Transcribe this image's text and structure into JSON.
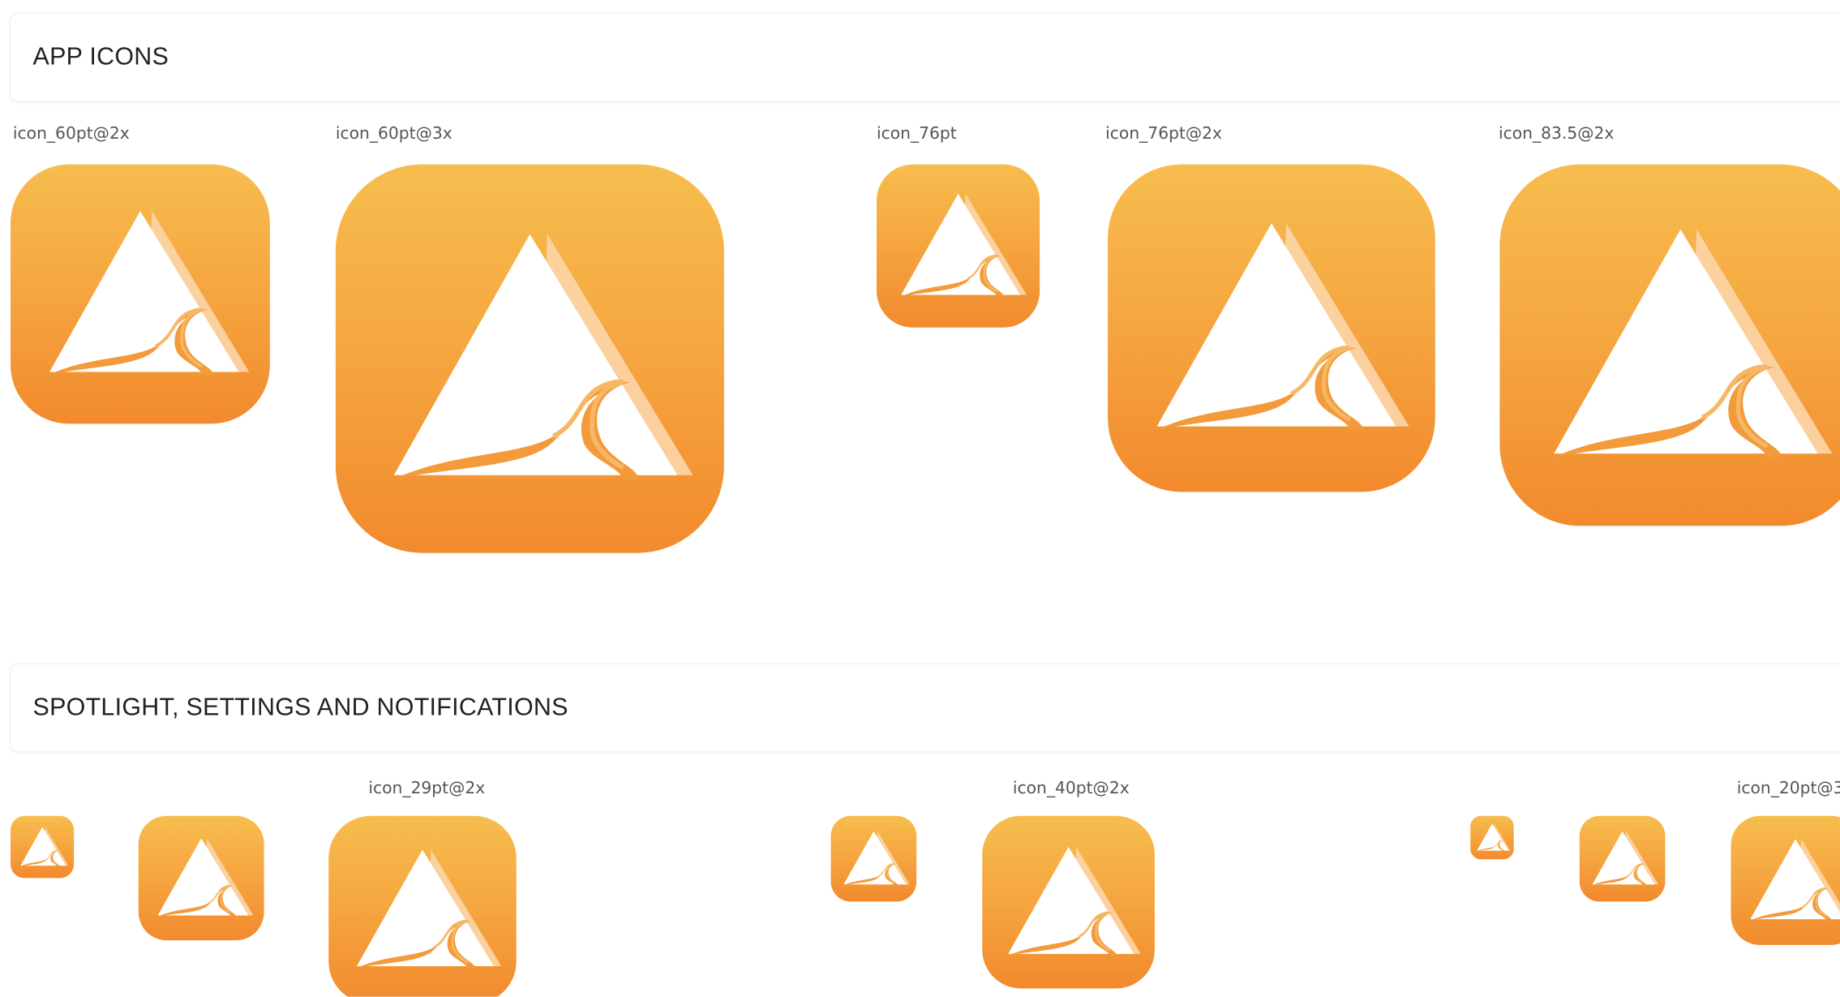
{
  "sections": {
    "app_icons": {
      "title": "APP ICONS",
      "labels": [
        "icon_60pt@2x",
        "icon_60pt@3x",
        "icon_76pt",
        "icon_76pt@2x",
        "icon_83.5@2x"
      ]
    },
    "spotlight": {
      "title": "SPOTLIGHT, SETTINGS AND NOTIFICATIONS",
      "labels": [
        "icon_29pt@2x",
        "icon_40pt@2x",
        "icon_20pt@3"
      ]
    }
  },
  "icon": {
    "name": "mountain-river-app-icon",
    "gradient_top": "#f7bd4e",
    "gradient_bottom": "#f28a2e"
  }
}
